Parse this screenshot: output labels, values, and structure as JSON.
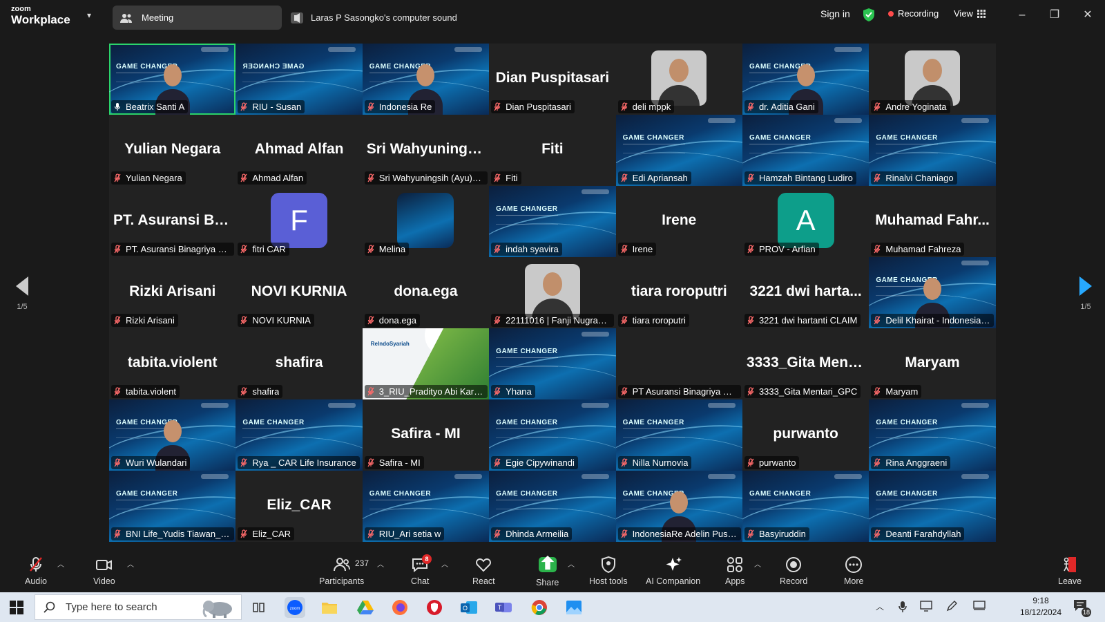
{
  "brand": {
    "line1": "zoom",
    "line2": "Workplace"
  },
  "topbar": {
    "meeting_label": "Meeting",
    "sound_label": "Laras P Sasongko's computer sound",
    "signin_label": "Sign in",
    "recording_label": "Recording",
    "view_label": "View"
  },
  "tiles": [
    {
      "name": "Beatrix Santi A",
      "type": "slide-cam",
      "active": true
    },
    {
      "name": "RIU - Susan",
      "type": "slide-mirror"
    },
    {
      "name": "Indonesia Re",
      "type": "slide-cam"
    },
    {
      "name": "Dian Puspitasari",
      "type": "name",
      "display": "Dian Puspitasari"
    },
    {
      "name": "deli mppk",
      "type": "face"
    },
    {
      "name": "dr. Aditia Gani",
      "type": "slide-cam"
    },
    {
      "name": "Andre Yoginata",
      "type": "face"
    },
    {
      "name": "Yulian Negara",
      "type": "name",
      "display": "Yulian Negara"
    },
    {
      "name": "Ahmad Alfan",
      "type": "name",
      "display": "Ahmad Alfan"
    },
    {
      "name": "Sri Wahyuningsih (Ayu)_...",
      "type": "name",
      "display": "Sri  Wahyunings..."
    },
    {
      "name": "Fiti",
      "type": "name",
      "display": "Fiti"
    },
    {
      "name": "Edi Apriansah",
      "type": "slide"
    },
    {
      "name": "Hamzah Bintang Ludiro",
      "type": "slide"
    },
    {
      "name": "Rinalvi Chaniago",
      "type": "slide"
    },
    {
      "name": "PT. Asuransi Binagriya Up...",
      "type": "name",
      "display": "PT.  Asuransi  Bin..."
    },
    {
      "name": "fitri CAR",
      "type": "avatar",
      "letter": "F",
      "color": "#5a5fd6"
    },
    {
      "name": "Melina",
      "type": "mini-slide"
    },
    {
      "name": "indah syavira",
      "type": "slide"
    },
    {
      "name": "Irene",
      "type": "name",
      "display": "Irene"
    },
    {
      "name": "PROV - Arfian",
      "type": "avatar",
      "letter": "A",
      "color": "#0d9e8a"
    },
    {
      "name": "Muhamad Fahreza",
      "type": "name",
      "display": "Muhamad  Fahr..."
    },
    {
      "name": "Rizki Arisani",
      "type": "name",
      "display": "Rizki Arisani"
    },
    {
      "name": "NOVI KURNIA",
      "type": "name",
      "display": "NOVI KURNIA"
    },
    {
      "name": "dona.ega",
      "type": "name",
      "display": "dona.ega"
    },
    {
      "name": "22111016 | Fanji Nugraha...",
      "type": "face"
    },
    {
      "name": "tiara roroputri",
      "type": "name",
      "display": "tiara roroputri"
    },
    {
      "name": "3221 dwi hartanti CLAIM",
      "type": "name",
      "display": "3221  dwi  harta..."
    },
    {
      "name": "Delil Khairat - Indonesia Re",
      "type": "slide-cam"
    },
    {
      "name": "tabita.violent",
      "type": "name",
      "display": "tabita.violent"
    },
    {
      "name": "shafira",
      "type": "name",
      "display": "shafira"
    },
    {
      "name": "3_RIU_Pradityo Abi Karami",
      "type": "reindo",
      "logo": "ReIndoSyariah"
    },
    {
      "name": "Yhana",
      "type": "slide"
    },
    {
      "name": "PT Asuransi Binagriya Upa...",
      "type": "blank"
    },
    {
      "name": "3333_Gita Mentari_GPC",
      "type": "name",
      "display": "3333_Gita  Ment..."
    },
    {
      "name": "Maryam",
      "type": "name",
      "display": "Maryam"
    },
    {
      "name": "Wuri Wulandari",
      "type": "slide-cam"
    },
    {
      "name": "Rya _ CAR Life Insurance",
      "type": "slide"
    },
    {
      "name": "Safira - MI",
      "type": "name",
      "display": "Safira - MI"
    },
    {
      "name": "Egie Cipywinandi",
      "type": "slide"
    },
    {
      "name": "Nilla Nurnovia",
      "type": "slide"
    },
    {
      "name": "purwanto",
      "type": "name",
      "display": "purwanto"
    },
    {
      "name": "Rina Anggraeni",
      "type": "slide"
    },
    {
      "name": "BNI Life_Yudis Tiawan_Aff...",
      "type": "slide"
    },
    {
      "name": "Eliz_CAR",
      "type": "name",
      "display": "Eliz_CAR"
    },
    {
      "name": "RIU_Ari setia w",
      "type": "slide"
    },
    {
      "name": "Dhinda Armeilia",
      "type": "slide"
    },
    {
      "name": "IndonesiaRe Adelin Puspit...",
      "type": "slide-cam"
    },
    {
      "name": "Basyiruddin",
      "type": "slide"
    },
    {
      "name": "Deanti Farahdyllah",
      "type": "slide"
    }
  ],
  "slide_text": {
    "title": "GAME CHANGER",
    "title_mirrored": "GAME CHANGER"
  },
  "pager": {
    "left": "1/5",
    "right": "1/5"
  },
  "toolbar": {
    "audio": "Audio",
    "video": "Video",
    "participants": "Participants",
    "participants_count": "237",
    "chat": "Chat",
    "chat_badge": "8",
    "react": "React",
    "share": "Share",
    "host_tools": "Host tools",
    "ai_companion": "AI Companion",
    "apps": "Apps",
    "record": "Record",
    "more": "More",
    "leave": "Leave"
  },
  "taskbar": {
    "search_placeholder": "Type here to search",
    "time": "9:18",
    "date": "18/12/2024",
    "notifications": "18"
  },
  "colors": {
    "accent": "#2bd46b",
    "recording": "#ff4b4b",
    "leave": "#e02828",
    "share": "#2bb34b"
  }
}
